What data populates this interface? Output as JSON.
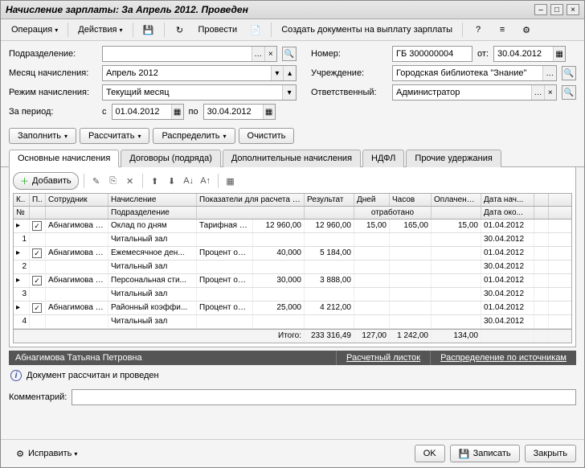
{
  "title": "Начисление зарплаты: За Апрель 2012. Проведен",
  "toolbar": {
    "operation": "Операция",
    "actions": "Действия",
    "post": "Провести",
    "create_docs": "Создать документы на выплату зарплаты"
  },
  "form": {
    "dept_label": "Подразделение:",
    "dept_value": "",
    "month_label": "Месяц начисления:",
    "month_value": "Апрель 2012",
    "mode_label": "Режим начисления:",
    "mode_value": "Текущий месяц",
    "period_label": "За период:",
    "from_lbl": "с",
    "from_value": "01.04.2012",
    "to_lbl": "по",
    "to_value": "30.04.2012",
    "number_label": "Номер:",
    "number_value": "ГБ 300000004",
    "ot_label": "от:",
    "date_value": "30.04.2012",
    "org_label": "Учреждение:",
    "org_value": "Городская библиотека \"Знание\"",
    "resp_label": "Ответственный:",
    "resp_value": "Администратор"
  },
  "actions": {
    "fill": "Заполнить",
    "calc": "Рассчитать",
    "distribute": "Распределить",
    "clear": "Очистить"
  },
  "tabs": {
    "t1": "Основные начисления",
    "t2": "Договоры (подряда)",
    "t3": "Дополнительные начисления",
    "t4": "НДФЛ",
    "t5": "Прочие удержания"
  },
  "subtoolbar": {
    "add": "Добавить"
  },
  "headers": {
    "k": "К..",
    "p": "П..",
    "emp": "Сотрудник",
    "accrual": "Начисление",
    "indicators": "Показатели для расчета начисления",
    "result": "Результат",
    "days": "Дней",
    "hours": "Часов",
    "paid": "Оплачено дней/часов",
    "date_start": "Дата нач...",
    "num": "№",
    "dept": "Подразделение",
    "worked": "отработано",
    "date_end": "Дата око..."
  },
  "rows": [
    {
      "n": "1",
      "emp": "Абнагимова Татьяна",
      "acc1": "Оклад по дням",
      "acc2": "Читальный зал",
      "ind": "Тарифная ставка",
      "ind2": "12 960,00",
      "res": "12 960,00",
      "d": "15,00",
      "h": "165,00",
      "pd": "15,00",
      "ds": "01.04.2012",
      "de": "30.04.2012"
    },
    {
      "n": "2",
      "emp": "Абнагимова Татьяна",
      "acc1": "Ежемесячное ден...",
      "acc2": "Читальный зал",
      "ind": "Процент оплаты",
      "ind2": "40,000",
      "res": "5 184,00",
      "d": "",
      "h": "",
      "pd": "",
      "ds": "01.04.2012",
      "de": "30.04.2012"
    },
    {
      "n": "3",
      "emp": "Абнагимова Татьяна",
      "acc1": "Персональная сти...",
      "acc2": "Читальный зал",
      "ind": "Процент оплаты",
      "ind2": "30,000",
      "res": "3 888,00",
      "d": "",
      "h": "",
      "pd": "",
      "ds": "01.04.2012",
      "de": "30.04.2012"
    },
    {
      "n": "4",
      "emp": "Абнагимова Татьяна",
      "acc1": "Районный коэффи...",
      "acc2": "Читальный зал",
      "ind": "Процент оплаты",
      "ind2": "25,000",
      "res": "4 212,00",
      "d": "",
      "h": "",
      "pd": "",
      "ds": "01.04.2012",
      "de": "30.04.2012"
    }
  ],
  "totals": {
    "label": "Итого:",
    "res": "233 316,49",
    "d": "127,00",
    "h": "1 242,00",
    "pd": "134,00"
  },
  "darkbar": {
    "name": "Абнагимова Татьяна Петровна",
    "link1": "Расчетный листок",
    "link2": "Распределение по источникам"
  },
  "info": "Документ рассчитан и проведен",
  "comment_label": "Комментарий:",
  "footer": {
    "fix": "Исправить",
    "ok": "OK",
    "write": "Записать",
    "close": "Закрыть"
  }
}
